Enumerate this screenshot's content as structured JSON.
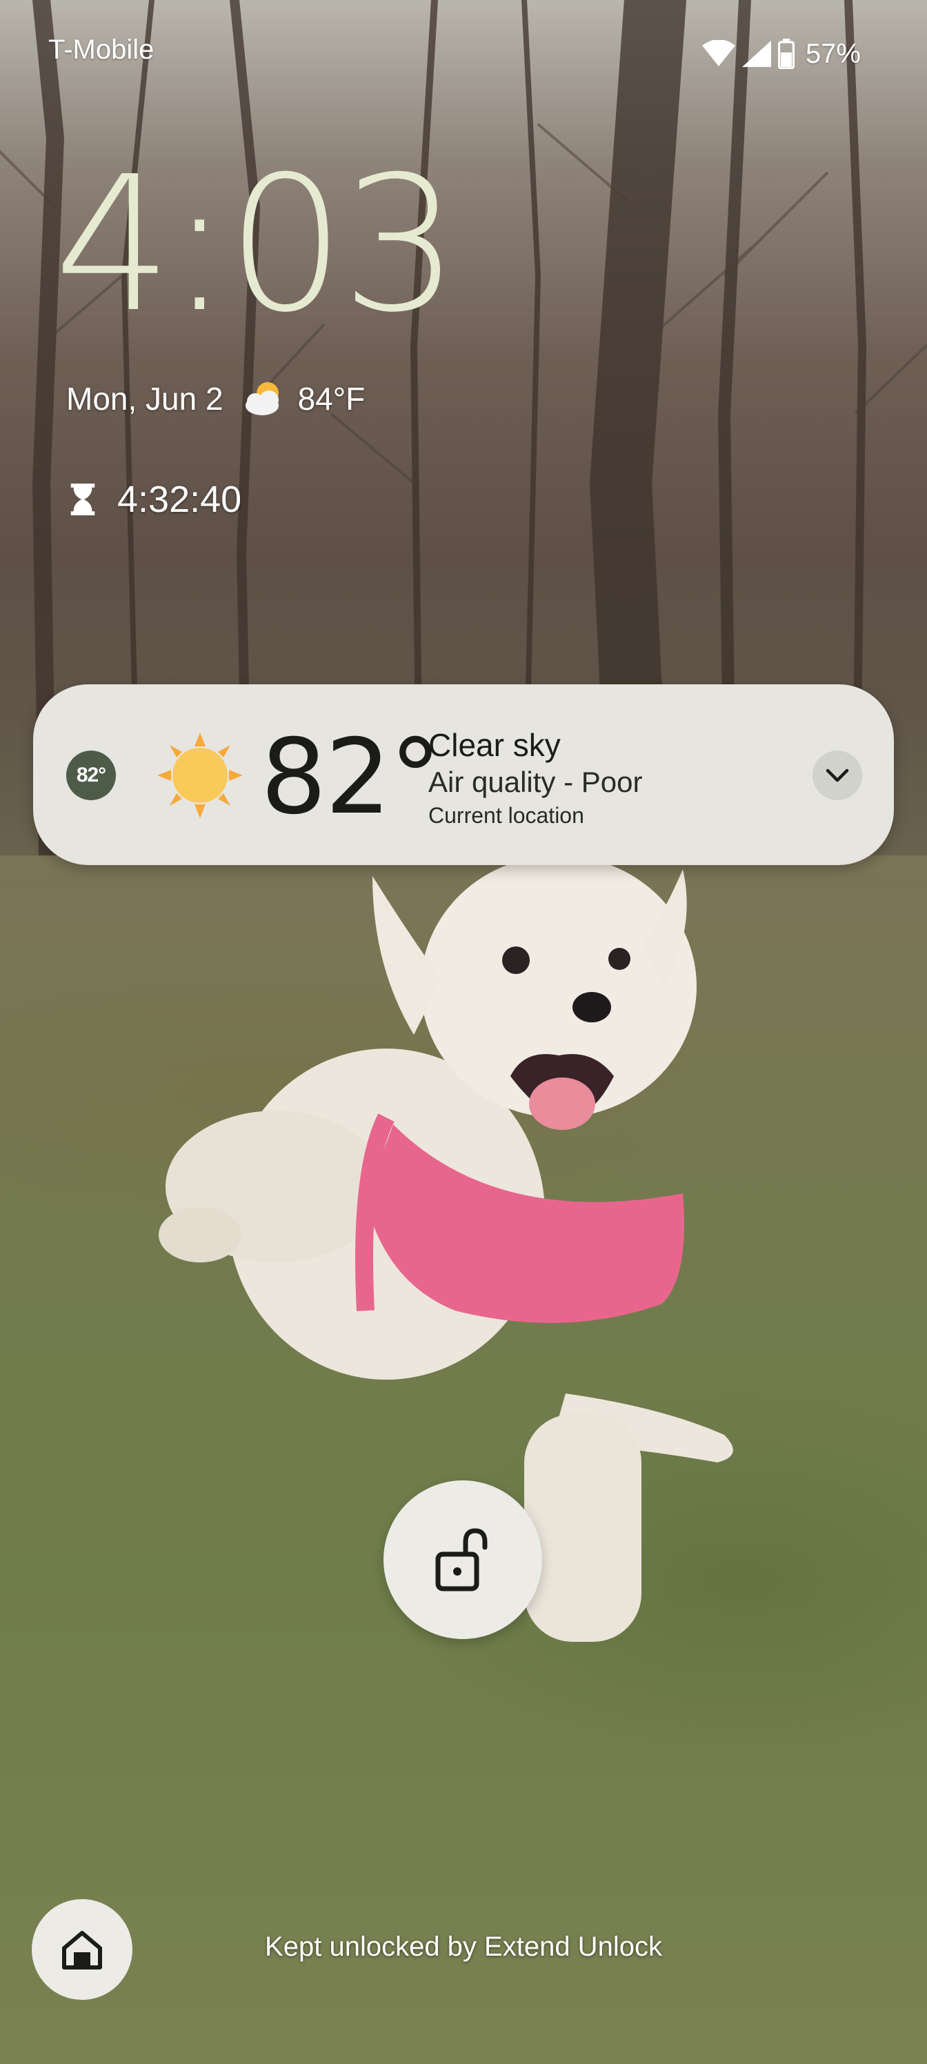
{
  "status_bar": {
    "carrier": "T-Mobile",
    "battery_percent": "57%",
    "icons": [
      "wifi-icon",
      "cell-signal-icon",
      "battery-icon"
    ]
  },
  "lock_screen": {
    "clock": "4:03",
    "date": "Mon, Jun 2",
    "weather_icon": "partly-cloudy-icon",
    "weather_temp": "84°F",
    "timer_icon": "hourglass-icon",
    "timer": "4:32:40"
  },
  "weather_card": {
    "badge_temp": "82°",
    "icon": "sun-icon",
    "temperature": "82°",
    "condition": "Clear sky",
    "air_quality": "Air quality - Poor",
    "location": "Current location",
    "expand_icon": "chevron-down-icon"
  },
  "lock_button": {
    "icon": "unlocked-padlock-icon"
  },
  "bottom": {
    "home_icon": "home-icon",
    "extend_unlock_text": "Kept unlocked by Extend Unlock"
  },
  "colors": {
    "clock": "#e5ead0",
    "card_background": "#e6e5e0",
    "badge": "#4f5b49",
    "sun": "#f9c95a"
  }
}
